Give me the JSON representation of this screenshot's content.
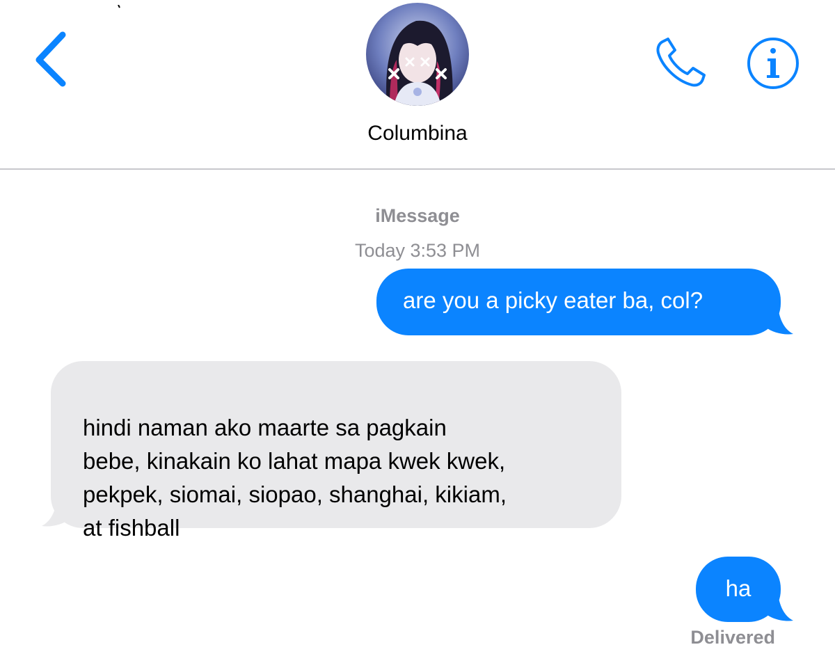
{
  "header": {
    "contact_name": "Columbina",
    "back_icon": "chevron-left-icon",
    "call_icon": "phone-icon",
    "info_icon": "info-icon"
  },
  "conversation": {
    "service": "iMessage",
    "timestamp": "Today 3:53 PM",
    "messages": [
      {
        "direction": "outgoing",
        "text": "are you a picky eater ba, col?"
      },
      {
        "direction": "incoming",
        "text": "hindi naman ako maarte sa pagkain\nbebe, kinakain ko lahat mapa kwek kwek,\npekpek, siomai, siopao, shanghai, kikiam,\nat fishball"
      },
      {
        "direction": "outgoing",
        "text": "ha"
      }
    ],
    "status": "Delivered"
  },
  "colors": {
    "accent": "#0b84ff",
    "outgoing_bubble": "#0b84ff",
    "incoming_bubble": "#e9e9eb",
    "secondary_text": "#8e8e93",
    "divider": "#c7c7cc"
  }
}
